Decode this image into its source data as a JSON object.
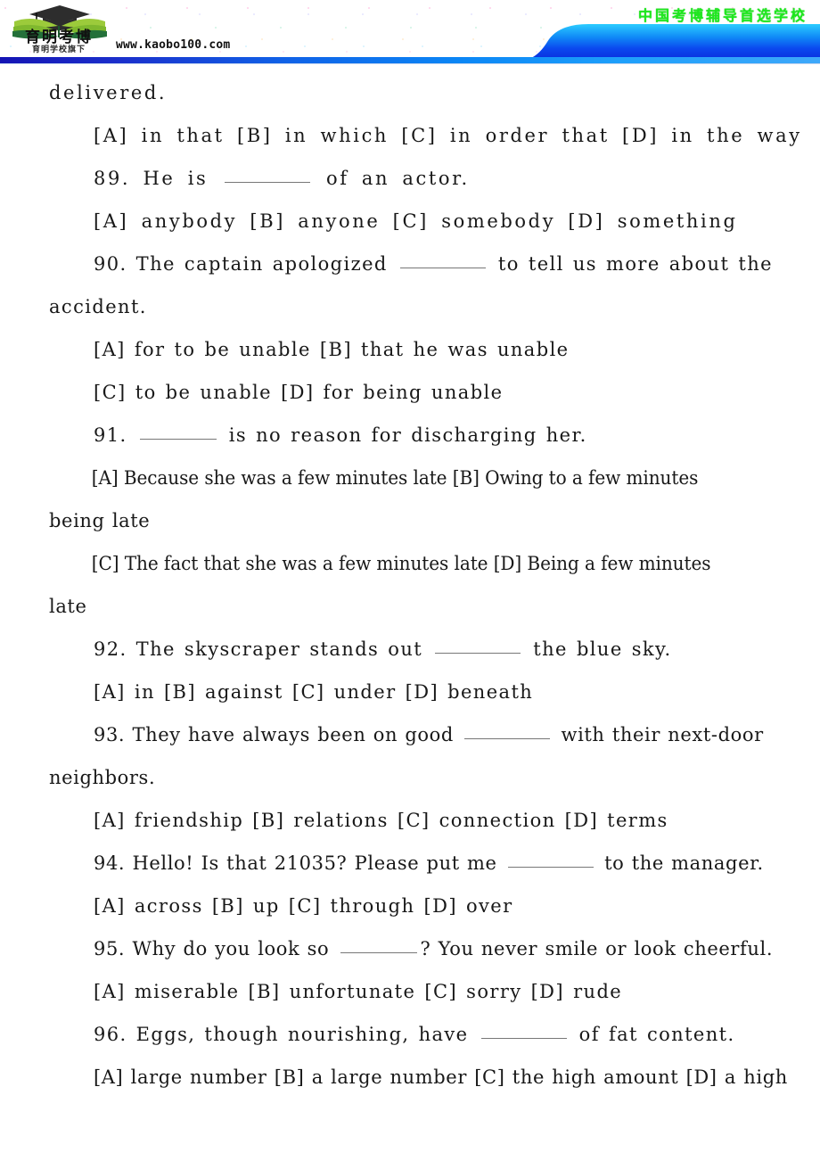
{
  "header": {
    "logo_main_text": "育明考博",
    "logo_sub_text": "育明学校旗下",
    "site_url": "www.kaobo100.com",
    "banner_text": "中国考博辅导首选学校",
    "banner_text_color": "#1ee81e",
    "banner_gradient_from": "#22c8ff",
    "banner_gradient_to": "#0a3ef0",
    "rule_color_left": "#1414b4",
    "rule_color_right": "#3ea8fa"
  },
  "content": {
    "continuation_line": "delivered.",
    "items": [
      {
        "id": "q88-options",
        "kind": "options",
        "lines": [
          {
            "text": "[A] in that [B] in which [C] in order that [D] in the way",
            "style": "mono",
            "indent": true
          }
        ]
      },
      {
        "id": "q89",
        "kind": "question",
        "lines": [
          {
            "pre": "89. He is ",
            "blank": "b-md",
            "post": " of an actor.",
            "style": "mono",
            "indent": true
          }
        ]
      },
      {
        "id": "q89-options",
        "kind": "options",
        "lines": [
          {
            "text": "[A] anybody [B] anyone [C] somebody [D] something",
            "style": "mono",
            "indent": true
          }
        ]
      },
      {
        "id": "q90",
        "kind": "question",
        "lines": [
          {
            "pre": "90. The captain apologized ",
            "blank": "b-md",
            "post": " to tell us more about the",
            "style": "semi",
            "indent": true
          },
          {
            "text": "accident.",
            "style": "semi",
            "indent": false
          }
        ]
      },
      {
        "id": "q90-options",
        "kind": "options",
        "lines": [
          {
            "text": "[A] for to be unable [B] that he was unable",
            "style": "semi",
            "indent": true
          },
          {
            "text": "[C] to be unable [D] for being unable",
            "style": "semi",
            "indent": true
          }
        ]
      },
      {
        "id": "q91",
        "kind": "question",
        "lines": [
          {
            "pre": "91. ",
            "blank": "b-sm",
            "post": " is no reason for discharging her.",
            "style": "semi",
            "indent": true
          }
        ]
      },
      {
        "id": "q91-options",
        "kind": "options",
        "lines": [
          {
            "text": "[A] Because she was a few minutes late [B] Owing to a few minutes",
            "style": "cond",
            "indent": true
          },
          {
            "text": "being late",
            "style": "tight",
            "indent": false
          },
          {
            "text": "[C] The fact that she was a few minutes late [D] Being a few minutes",
            "style": "cond",
            "indent": true
          },
          {
            "text": "late",
            "style": "tight",
            "indent": false
          }
        ]
      },
      {
        "id": "q92",
        "kind": "question",
        "lines": [
          {
            "pre": "92. The skyscraper stands out ",
            "blank": "b-md",
            "post": " the blue sky.",
            "style": "semi",
            "indent": true
          }
        ]
      },
      {
        "id": "q92-options",
        "kind": "options",
        "lines": [
          {
            "text": "[A] in [B] against [C] under [D] beneath",
            "style": "semi",
            "indent": true
          }
        ]
      },
      {
        "id": "q93",
        "kind": "question",
        "lines": [
          {
            "pre": "93. They have always been on good ",
            "blank": "b-md",
            "post": " with their next-door",
            "style": "tight",
            "indent": true
          },
          {
            "text": "neighbors.",
            "style": "tight",
            "indent": false
          }
        ]
      },
      {
        "id": "q93-options",
        "kind": "options",
        "lines": [
          {
            "text": "[A] friendship [B] relations [C] connection [D] terms",
            "style": "semi",
            "indent": true
          }
        ]
      },
      {
        "id": "q94",
        "kind": "question",
        "lines": [
          {
            "pre": "94. Hello! Is that 21035? Please put me ",
            "blank": "b-md",
            "post": " to the manager.",
            "style": "tight",
            "indent": true
          }
        ]
      },
      {
        "id": "q94-options",
        "kind": "options",
        "lines": [
          {
            "text": "[A] across [B] up [C] through [D] over",
            "style": "semi",
            "indent": true
          }
        ]
      },
      {
        "id": "q95",
        "kind": "question",
        "lines": [
          {
            "pre": "95. Why do you look so ",
            "blank": "b-sm",
            "post": "? You never smile or look cheerful.",
            "style": "tight",
            "indent": true
          }
        ]
      },
      {
        "id": "q95-options",
        "kind": "options",
        "lines": [
          {
            "text": "[A] miserable [B] unfortunate [C] sorry [D] rude",
            "style": "semi",
            "indent": true
          }
        ]
      },
      {
        "id": "q96",
        "kind": "question",
        "lines": [
          {
            "pre": "96. Eggs, though nourishing, have ",
            "blank": "b-md",
            "post": " of fat content.",
            "style": "semi",
            "indent": true
          }
        ]
      },
      {
        "id": "q96-options",
        "kind": "options",
        "lines": [
          {
            "text": "[A] large number [B] a large number [C] the high amount [D] a high",
            "style": "tight",
            "indent": true
          }
        ]
      }
    ]
  }
}
